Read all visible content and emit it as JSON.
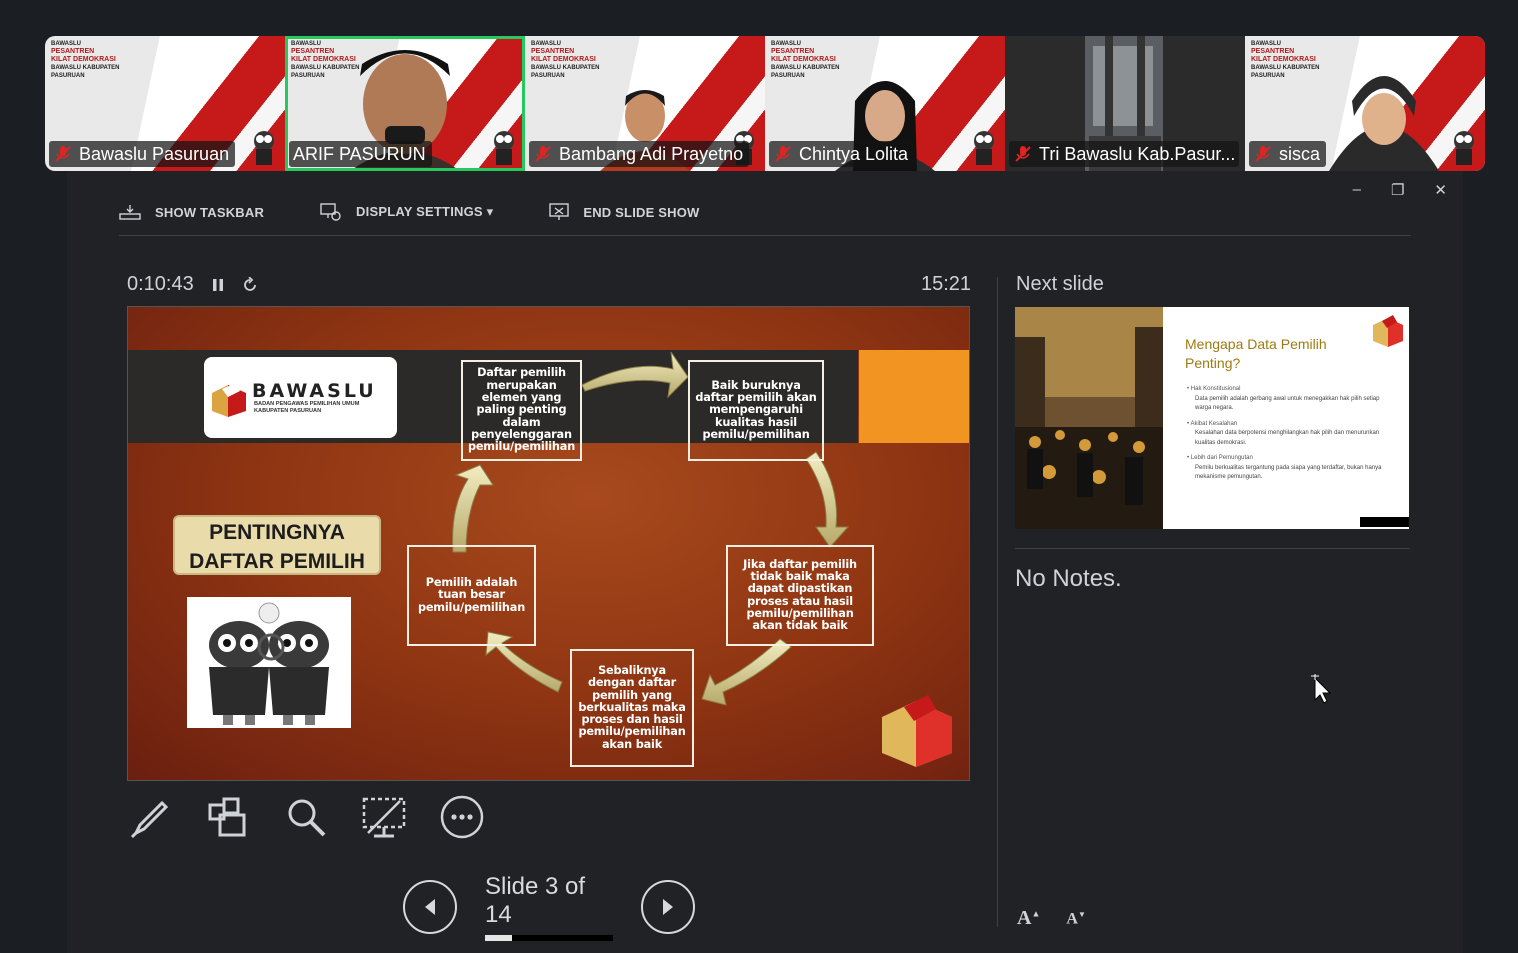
{
  "participants": [
    {
      "name": "Bawaslu Pasuruan",
      "muted": true,
      "active": false,
      "kind": "banner"
    },
    {
      "name": "ARIF PASURUN",
      "muted": false,
      "active": true,
      "kind": "person-male"
    },
    {
      "name": "Bambang Adi Prayetno",
      "muted": true,
      "active": false,
      "kind": "person-male2"
    },
    {
      "name": "Chintya Lolita",
      "muted": true,
      "active": false,
      "kind": "person-female"
    },
    {
      "name": "Tri Bawaslu Kab.Pasur...",
      "muted": true,
      "active": false,
      "kind": "room"
    },
    {
      "name": "sisca",
      "muted": true,
      "active": false,
      "kind": "person-hijab"
    }
  ],
  "banner": {
    "line1": "BAWASLU",
    "line2": "PESANTREN",
    "line3": "KILAT DEMOKRASI",
    "line4": "BAWASLU KABUPATEN PASURUAN"
  },
  "window_controls": {
    "minimize": "–",
    "restore": "❐",
    "close": "✕"
  },
  "toolbar": {
    "show_taskbar": "SHOW TASKBAR",
    "display_settings": "DISPLAY SETTINGS ▾",
    "end_slide_show": "END SLIDE SHOW"
  },
  "timer": {
    "elapsed": "0:10:43",
    "clock": "15:21"
  },
  "slide": {
    "logo_name": "BAWASLU",
    "logo_sub": "BADAN PENGAWAS PEMILIHAN UMUM KABUPATEN PASURUAN",
    "title_line1": "PENTINGNYA",
    "title_line2": "DAFTAR PEMILIH",
    "steps": [
      "Daftar pemilih merupakan elemen yang paling penting dalam penyelenggaran pemilu/pemilihan",
      "Baik buruknya daftar pemilih akan mempengaruhi kualitas hasil pemilu/pemilihan",
      "Jika daftar pemilih tidak baik maka dapat dipastikan proses atau hasil pemilu/pemilihan akan tidak baik",
      "Sebaliknya dengan daftar pemilih yang berkualitas maka proses dan hasil pemilu/pemilihan akan baik",
      "Pemilih adalah tuan besar pemilu/pemilihan"
    ]
  },
  "slide_tools": {
    "pen": "pen-icon",
    "see_all": "see-all-slides-icon",
    "zoom": "zoom-icon",
    "black_screen": "black-screen-icon",
    "more": "more-options-icon"
  },
  "navigation": {
    "counter": "Slide 3 of 14",
    "current": 3,
    "total": 14
  },
  "next_slide": {
    "label": "Next slide",
    "title": "Mengapa Data Pemilih Penting?",
    "bullets": [
      {
        "head": "Hak Konstitusional",
        "text": "Data pemilih adalah gerbang awal untuk menegakkan hak pilih setiap warga negara."
      },
      {
        "head": "Akibat Kesalahan",
        "text": "Kesalahan data berpotensi menghilangkan hak pilih dan menurunkan kualitas demokrasi."
      },
      {
        "head": "Lebih dari Pemungutan",
        "text": "Pemilu berkualitas tergantung pada siapa yang terdaftar, bukan hanya mekanisme pemungutan."
      }
    ]
  },
  "notes": "No Notes.",
  "font_tools": {
    "increase": "A",
    "decrease": "A"
  },
  "colors": {
    "accent_green": "#27c95e",
    "bawaslu_red": "#c61a1a",
    "slide_orange": "#f29421"
  }
}
